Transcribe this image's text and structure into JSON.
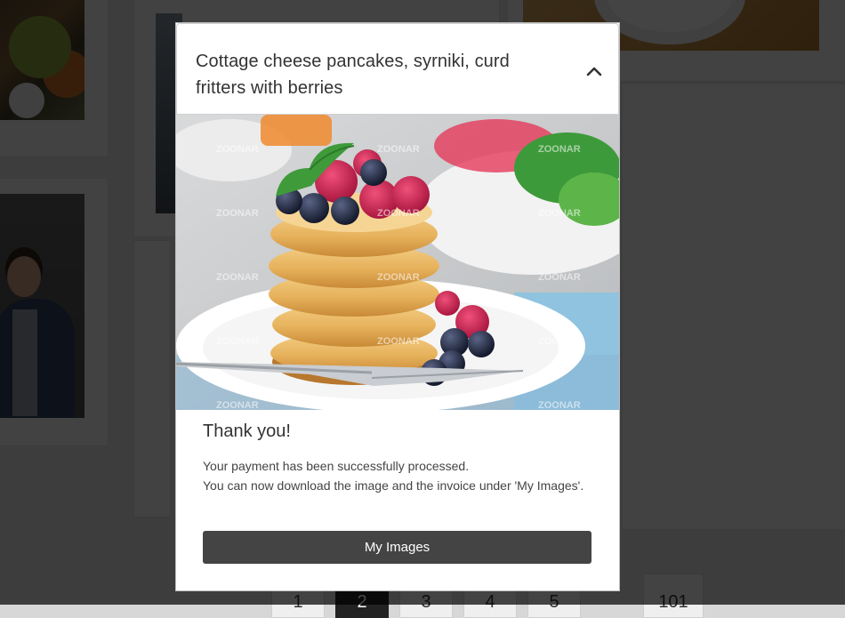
{
  "modal": {
    "title": "Cottage cheese pancakes, syrniki, curd fritters with berries",
    "collapse_icon": "chevron-up-icon",
    "image_alt": "Stack of cottage cheese pancakes with raspberries, blueberries and mint on a white plate with a fork",
    "watermark": "ZOONAR",
    "thanks_heading": "Thank you!",
    "message_line1": "Your payment has been successfully processed.",
    "message_line2": "You can now download the image and the invoice under 'My Images'.",
    "button_label": "My Images"
  },
  "pagination": {
    "pages": [
      "1",
      "2",
      "3",
      "4",
      "5"
    ],
    "active": "2",
    "last": "101"
  },
  "colors": {
    "overlay": "#000000",
    "button_bg": "#444444",
    "active_page": "#222222"
  }
}
